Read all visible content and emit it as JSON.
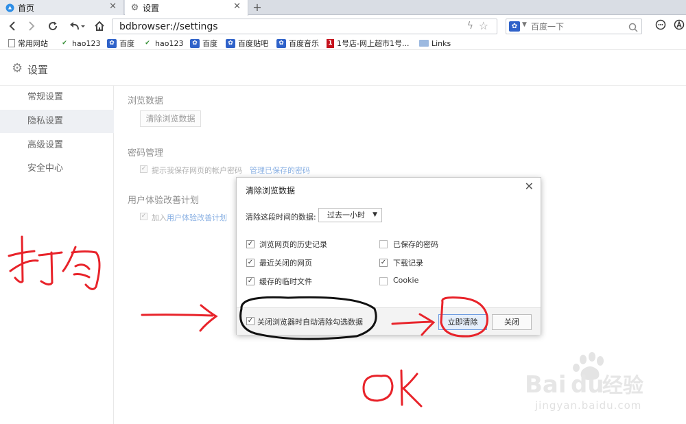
{
  "tabs": [
    {
      "label": "首页",
      "close": "✕"
    },
    {
      "label": "设置",
      "close": "✕"
    }
  ],
  "new_tab": "+",
  "address": {
    "url": "bdbrowser://settings"
  },
  "search": {
    "placeholder": "百度一下"
  },
  "bookmarks": [
    {
      "label": "常用网站",
      "icon": "page-icon"
    },
    {
      "label": "hao123",
      "icon": "hao123-icon"
    },
    {
      "label": "百度",
      "icon": "baidu-paw-icon"
    },
    {
      "label": "hao123",
      "icon": "hao123-icon"
    },
    {
      "label": "百度",
      "icon": "baidu-paw-icon"
    },
    {
      "label": "百度贴吧",
      "icon": "baidu-paw-icon"
    },
    {
      "label": "百度音乐",
      "icon": "baidu-paw-icon"
    },
    {
      "label": "1号店-网上超市1号...",
      "icon": "yhd-icon"
    },
    {
      "label": "Links",
      "icon": "folder-icon"
    }
  ],
  "page": {
    "title": "设置"
  },
  "sidebar": {
    "items": [
      {
        "label": "常规设置",
        "active": false
      },
      {
        "label": "隐私设置",
        "active": true
      },
      {
        "label": "高级设置",
        "active": false
      },
      {
        "label": "安全中心",
        "active": false
      }
    ]
  },
  "privacy": {
    "browse_data_title": "浏览数据",
    "clear_button": "清除浏览数据",
    "password_title": "密码管理",
    "password_option": "提示我保存网页的帐户密码",
    "manage_passwords_link": "管理已保存的密码",
    "ux_title": "用户体验改善计划",
    "ux_option_prefix": "加入",
    "ux_option_link": "用户体验改善计划"
  },
  "dialog": {
    "title": "清除浏览数据",
    "close": "✕",
    "range_label": "清除这段时间的数据:",
    "range_value": "过去一小时",
    "options": [
      {
        "label": "浏览网页的历史记录",
        "checked": true
      },
      {
        "label": "已保存的密码",
        "checked": false
      },
      {
        "label": "最近关闭的网页",
        "checked": true
      },
      {
        "label": "下载记录",
        "checked": true
      },
      {
        "label": "缓存的临时文件",
        "checked": true
      },
      {
        "label": "Cookie",
        "checked": false
      }
    ],
    "auto_clear_label": "关闭浏览器时自动清除勾选数据",
    "auto_clear_checked": true,
    "clear_now_button": "立即清除",
    "close_button": "关闭"
  },
  "annotations": {
    "left_text": "打勾",
    "bottom_text": "OK",
    "color": "#e8232a"
  },
  "watermark": {
    "domain": "jingyan.baidu.com",
    "logo": "Baidu经验"
  },
  "colors": {
    "link": "#4a86d4",
    "primary_border": "#6c9be0",
    "annotation": "#e8232a"
  }
}
